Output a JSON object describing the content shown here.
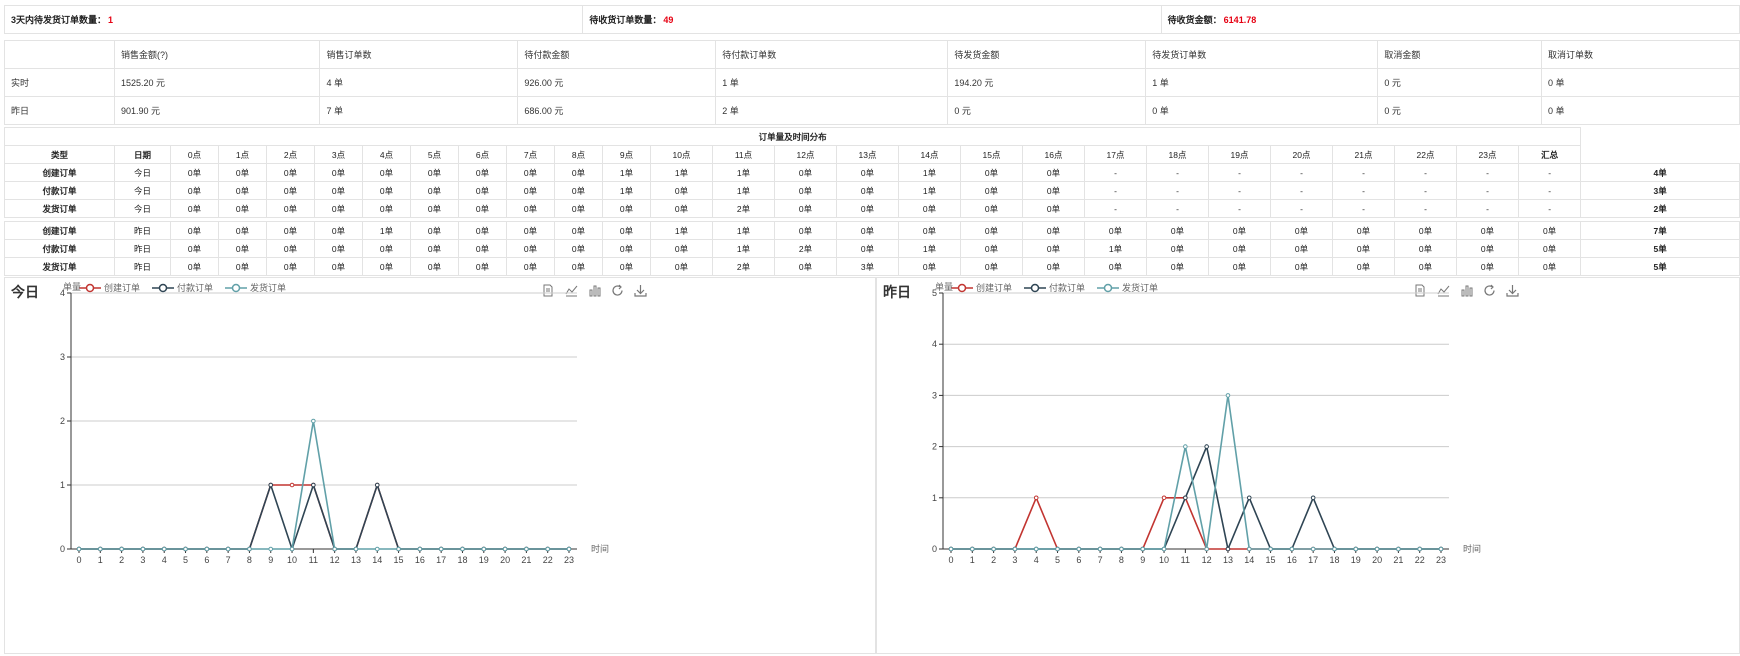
{
  "summary": {
    "items": [
      {
        "label": "3天内待发货订单数量：",
        "value": "1"
      },
      {
        "label": "待收货订单数量：",
        "value": "49"
      },
      {
        "label": "待收货金额：",
        "value": "6141.78"
      }
    ]
  },
  "sales": {
    "headers": [
      "",
      "销售金额(?)",
      "销售订单数",
      "待付款金额",
      "待付款订单数",
      "待发货金额",
      "待发货订单数",
      "取消金额",
      "取消订单数"
    ],
    "rows": [
      {
        "cells": [
          "实时",
          "1525.20 元",
          "4 单",
          "926.00 元",
          "1 单",
          "194.20 元",
          "1 单",
          "0 元",
          "0 单"
        ],
        "red": [
          1,
          2,
          3,
          4
        ]
      },
      {
        "cells": [
          "昨日",
          "901.90 元",
          "7 单",
          "686.00 元",
          "2 单",
          "0 元",
          "0 单",
          "0 元",
          "0 单"
        ],
        "red": [
          1,
          2
        ]
      }
    ]
  },
  "distribution": {
    "title": "订单量及时间分布",
    "headers": [
      "类型",
      "日期",
      "0点",
      "1点",
      "2点",
      "3点",
      "4点",
      "5点",
      "6点",
      "7点",
      "8点",
      "9点",
      "10点",
      "11点",
      "12点",
      "13点",
      "14点",
      "15点",
      "16点",
      "17点",
      "18点",
      "19点",
      "20点",
      "21点",
      "22点",
      "23点",
      "汇总"
    ],
    "today_rows": [
      {
        "type": "创建订单",
        "date": "今日",
        "cells": [
          "0单",
          "0单",
          "0单",
          "0单",
          "0单",
          "0单",
          "0单",
          "0单",
          "0单",
          "1单",
          "1单",
          "1单",
          "0单",
          "0单",
          "1单",
          "0单",
          "0单",
          "-",
          "-",
          "-",
          "-",
          "-",
          "-",
          "-",
          "-",
          "4单"
        ]
      },
      {
        "type": "付款订单",
        "date": "今日",
        "cells": [
          "0单",
          "0单",
          "0单",
          "0单",
          "0单",
          "0单",
          "0单",
          "0单",
          "0单",
          "1单",
          "0单",
          "1单",
          "0单",
          "0单",
          "1单",
          "0单",
          "0单",
          "-",
          "-",
          "-",
          "-",
          "-",
          "-",
          "-",
          "-",
          "3单"
        ]
      },
      {
        "type": "发货订单",
        "date": "今日",
        "cells": [
          "0单",
          "0单",
          "0单",
          "0单",
          "0单",
          "0单",
          "0单",
          "0单",
          "0单",
          "0单",
          "0单",
          "2单",
          "0单",
          "0单",
          "0单",
          "0单",
          "0单",
          "-",
          "-",
          "-",
          "-",
          "-",
          "-",
          "-",
          "-",
          "2单"
        ]
      }
    ],
    "yesterday_rows": [
      {
        "type": "创建订单",
        "date": "昨日",
        "cells": [
          "0单",
          "0单",
          "0单",
          "0单",
          "1单",
          "0单",
          "0单",
          "0单",
          "0单",
          "0单",
          "1单",
          "1单",
          "0单",
          "0单",
          "0单",
          "0单",
          "0单",
          "0单",
          "0单",
          "0单",
          "0单",
          "0单",
          "0单",
          "0单",
          "0单",
          "7单"
        ]
      },
      {
        "type": "付款订单",
        "date": "昨日",
        "cells": [
          "0单",
          "0单",
          "0单",
          "0单",
          "0单",
          "0单",
          "0单",
          "0单",
          "0单",
          "0单",
          "0单",
          "1单",
          "2单",
          "0单",
          "1单",
          "0单",
          "0单",
          "1单",
          "0单",
          "0单",
          "0单",
          "0单",
          "0单",
          "0单",
          "0单",
          "5单"
        ]
      },
      {
        "type": "发货订单",
        "date": "昨日",
        "cells": [
          "0单",
          "0单",
          "0单",
          "0单",
          "0单",
          "0单",
          "0单",
          "0单",
          "0单",
          "0单",
          "0单",
          "2单",
          "0单",
          "3单",
          "0单",
          "0单",
          "0单",
          "0单",
          "0单",
          "0单",
          "0单",
          "0单",
          "0单",
          "0单",
          "0单",
          "5单"
        ]
      }
    ]
  },
  "chart_data": [
    {
      "type": "line",
      "title": "今日",
      "ylabel": "单量",
      "xlabel": "时间",
      "x": [
        0,
        1,
        2,
        3,
        4,
        5,
        6,
        7,
        8,
        9,
        10,
        11,
        12,
        13,
        14,
        15,
        16,
        17,
        18,
        19,
        20,
        21,
        22,
        23
      ],
      "ylim": [
        0,
        4
      ],
      "yticks": [
        0,
        1,
        2,
        3,
        4
      ],
      "series": [
        {
          "name": "创建订单",
          "color": "#c23531",
          "values": [
            0,
            0,
            0,
            0,
            0,
            0,
            0,
            0,
            0,
            1,
            1,
            1,
            0,
            0,
            1,
            0,
            0,
            0,
            0,
            0,
            0,
            0,
            0,
            0
          ]
        },
        {
          "name": "付款订单",
          "color": "#2f4554",
          "values": [
            0,
            0,
            0,
            0,
            0,
            0,
            0,
            0,
            0,
            1,
            0,
            1,
            0,
            0,
            1,
            0,
            0,
            0,
            0,
            0,
            0,
            0,
            0,
            0
          ]
        },
        {
          "name": "发货订单",
          "color": "#61a0a8",
          "values": [
            0,
            0,
            0,
            0,
            0,
            0,
            0,
            0,
            0,
            0,
            0,
            2,
            0,
            0,
            0,
            0,
            0,
            0,
            0,
            0,
            0,
            0,
            0,
            0
          ]
        }
      ]
    },
    {
      "type": "line",
      "title": "昨日",
      "ylabel": "单量",
      "xlabel": "时间",
      "x": [
        0,
        1,
        2,
        3,
        4,
        5,
        6,
        7,
        8,
        9,
        10,
        11,
        12,
        13,
        14,
        15,
        16,
        17,
        18,
        19,
        20,
        21,
        22,
        23
      ],
      "ylim": [
        0,
        5
      ],
      "yticks": [
        0,
        1,
        2,
        3,
        4,
        5
      ],
      "series": [
        {
          "name": "创建订单",
          "color": "#c23531",
          "values": [
            0,
            0,
            0,
            0,
            1,
            0,
            0,
            0,
            0,
            0,
            1,
            1,
            0,
            0,
            0,
            0,
            0,
            0,
            0,
            0,
            0,
            0,
            0,
            0
          ]
        },
        {
          "name": "付款订单",
          "color": "#2f4554",
          "values": [
            0,
            0,
            0,
            0,
            0,
            0,
            0,
            0,
            0,
            0,
            0,
            1,
            2,
            0,
            1,
            0,
            0,
            1,
            0,
            0,
            0,
            0,
            0,
            0
          ]
        },
        {
          "name": "发货订单",
          "color": "#61a0a8",
          "values": [
            0,
            0,
            0,
            0,
            0,
            0,
            0,
            0,
            0,
            0,
            0,
            2,
            0,
            3,
            0,
            0,
            0,
            0,
            0,
            0,
            0,
            0,
            0,
            0
          ]
        }
      ]
    }
  ],
  "toolbox": [
    "data-view-icon",
    "line-chart-icon",
    "bar-chart-icon",
    "restore-icon",
    "download-icon"
  ]
}
